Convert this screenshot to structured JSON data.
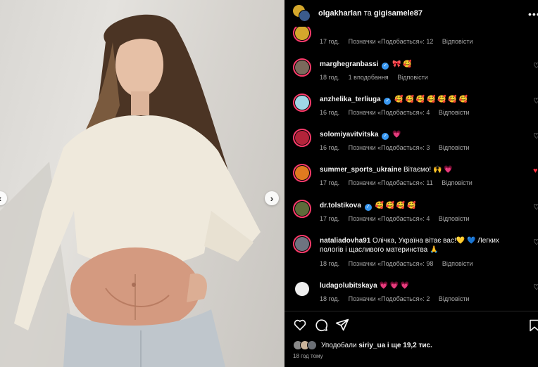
{
  "post": {
    "author": "olgakharlan",
    "conjunction": "та",
    "coauthor": "gigisamele87",
    "time_ago": "18 год тому"
  },
  "likes": {
    "prefix": "Уподобали",
    "user": "siriy_ua",
    "suffix": "і ще 19,2 тис."
  },
  "comments": [
    {
      "username": "",
      "verified": false,
      "text": "",
      "time": "17 год.",
      "likes": "Позначки «Подобається»: 12",
      "reply": "Відповісти",
      "avatar_color": "#d4a72c",
      "heart_red": false
    },
    {
      "username": "marghegranbassi",
      "verified": true,
      "text": "🎀 🥰",
      "time": "18 год.",
      "likes": "1 вподобання",
      "reply": "Відповісти",
      "avatar_color": "#7a6a5c",
      "heart_red": false
    },
    {
      "username": "anzhelika_terliuga",
      "verified": true,
      "text": "🥰 🥰 🥰 🥰 🥰 🥰 🥰",
      "time": "16 год.",
      "likes": "Позначки «Подобається»: 4",
      "reply": "Відповісти",
      "avatar_color": "#9fd6e6",
      "heart_red": false
    },
    {
      "username": "solomiyavitvitska",
      "verified": true,
      "text": "💗",
      "time": "16 год.",
      "likes": "Позначки «Подобається»: 3",
      "reply": "Відповісти",
      "avatar_color": "#b3243a",
      "heart_red": false
    },
    {
      "username": "summer_sports_ukraine",
      "verified": false,
      "text": "Вітаємо! 🙌 💗",
      "time": "17 год.",
      "likes": "Позначки «Подобається»: 11",
      "reply": "Відповісти",
      "avatar_color": "#e07a1f",
      "heart_red": true
    },
    {
      "username": "dr.tolstikova",
      "verified": true,
      "text": "🥰 🥰 🥰 🥰",
      "time": "17 год.",
      "likes": "Позначки «Подобається»: 4",
      "reply": "Відповісти",
      "avatar_color": "#5d6b3a",
      "heart_red": false
    },
    {
      "username": "nataliadovha91",
      "verified": false,
      "text": "Олічка, Україна вітає вас!💛 💙 Легких пологів і щасливого материнства 🙏",
      "time": "18 год.",
      "likes": "Позначки «Подобається»: 98",
      "reply": "Відповісти",
      "avatar_color": "#6e7480",
      "heart_red": false
    },
    {
      "username": "ludagolubitskaya",
      "verified": false,
      "text": "💗 💗 💗",
      "time": "18 год.",
      "likes": "Позначки «Подобається»: 2",
      "reply": "Відповісти",
      "avatar_color": "#eeeeee",
      "heart_red": false
    }
  ],
  "icons": {
    "more": "more-icon",
    "like": "heart-icon",
    "comment": "comment-icon",
    "share": "share-icon",
    "save": "bookmark-icon",
    "prev": "chevron-left-icon",
    "next": "chevron-right-icon"
  },
  "colors": {
    "background": "#000000",
    "text": "#f5f5f5",
    "muted": "#a8a8a8",
    "verified": "#3897f0",
    "story_ring": "#ff3b6b",
    "liked_heart": "#ff3040"
  }
}
